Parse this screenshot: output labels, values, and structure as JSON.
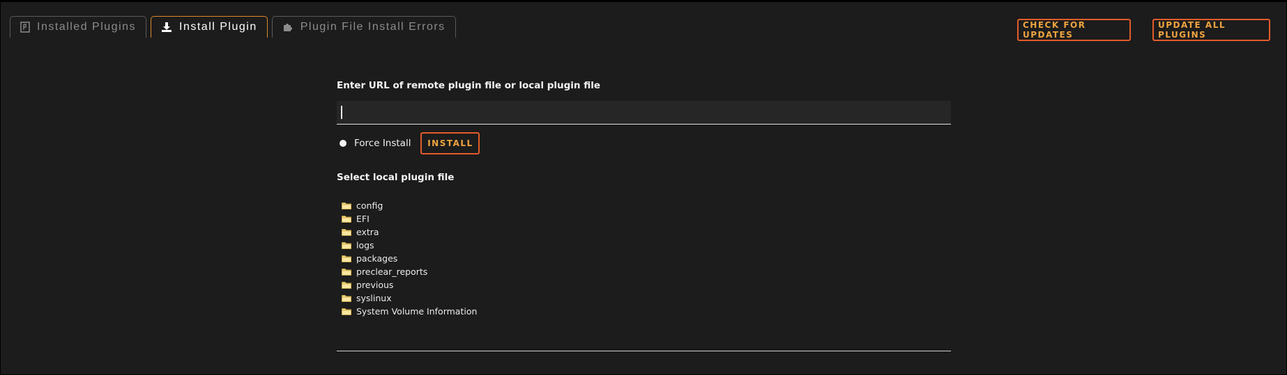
{
  "tabs": [
    {
      "label": "Installed Plugins",
      "icon": "plugin-icon",
      "active": false
    },
    {
      "label": "Install Plugin",
      "icon": "download-icon",
      "active": true
    },
    {
      "label": "Plugin File Install Errors",
      "icon": "puzzle-icon",
      "active": false
    }
  ],
  "header_buttons": {
    "check_updates": "CHECK FOR UPDATES",
    "update_all": "UPDATE ALL PLUGINS"
  },
  "install": {
    "url_label": "Enter URL of remote plugin file or local plugin file",
    "url_value": "",
    "force_install_label": "Force Install",
    "install_button": "INSTALL"
  },
  "local_files": {
    "label": "Select local plugin file",
    "items": [
      "config",
      "EFI",
      "extra",
      "logs",
      "packages",
      "preclear_reports",
      "previous",
      "syslinux",
      "System Volume Information"
    ]
  },
  "colors": {
    "background": "#1c1c1c",
    "accent_border": "#e35b2c",
    "accent_text": "#f0a340",
    "tab_active_border": "#d98b2b",
    "folder": "#f4d77a"
  }
}
